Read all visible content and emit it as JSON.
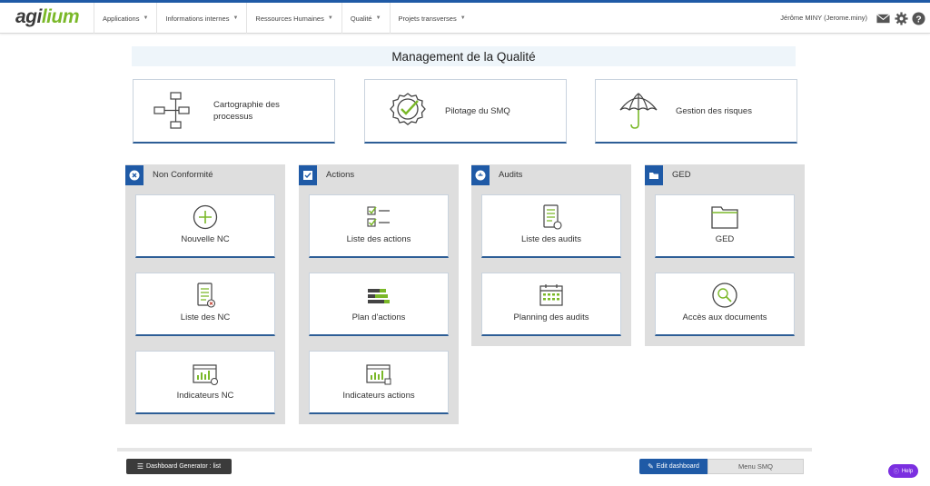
{
  "app": {
    "logo_text_a": "agi",
    "logo_text_b": "lium"
  },
  "nav": [
    {
      "label": "Applications"
    },
    {
      "label": "Informations internes"
    },
    {
      "label": "Ressources Humaines"
    },
    {
      "label": "Qualité"
    },
    {
      "label": "Projets transverses"
    }
  ],
  "user": {
    "name": "Jérôme MINY (Jerome.miny)"
  },
  "toolbar_icons": [
    "mail-icon",
    "gear-icon",
    "question-circle-icon"
  ],
  "page_title": "Management de la Qualité",
  "big_cards": [
    {
      "label": "Cartographie des processus",
      "icon": "process-map-icon"
    },
    {
      "label": "Pilotage du SMQ",
      "icon": "check-seal-icon"
    },
    {
      "label": "Gestion des risques",
      "icon": "umbrella-icon"
    }
  ],
  "sections": [
    {
      "title": "Non Conformité",
      "icon": "circle-x-icon",
      "tiles": [
        {
          "label": "Nouvelle NC",
          "icon": "plus-circle-icon"
        },
        {
          "label": "Liste des NC",
          "icon": "list-doc-icon"
        },
        {
          "label": "Indicateurs NC",
          "icon": "indicator-icon"
        }
      ]
    },
    {
      "title": "Actions",
      "icon": "checkbox-icon",
      "tiles": [
        {
          "label": "Liste des actions",
          "icon": "checklist-icon"
        },
        {
          "label": "Plan d'actions",
          "icon": "gantt-icon"
        },
        {
          "label": "Indicateurs actions",
          "icon": "indicator-icon"
        }
      ]
    },
    {
      "title": "Audits",
      "icon": "audit-icon",
      "tiles": [
        {
          "label": "Liste des audits",
          "icon": "audit-doc-icon"
        },
        {
          "label": "Planning des audits",
          "icon": "calendar-icon"
        }
      ]
    },
    {
      "title": "GED",
      "icon": "folder-icon",
      "tiles": [
        {
          "label": "GED",
          "icon": "folder-outline-icon"
        },
        {
          "label": "Accès aux documents",
          "icon": "magnifier-icon"
        }
      ]
    }
  ],
  "footer": {
    "dashboard_button": "Dashboard Generator : list",
    "edit_button": "Edit dashboard",
    "menu_button": "Menu SMQ",
    "help_button": "Help"
  },
  "colors": {
    "primary": "#1f5aa6",
    "accent_green": "#7ab828",
    "help_purple": "#7b2fe0"
  }
}
